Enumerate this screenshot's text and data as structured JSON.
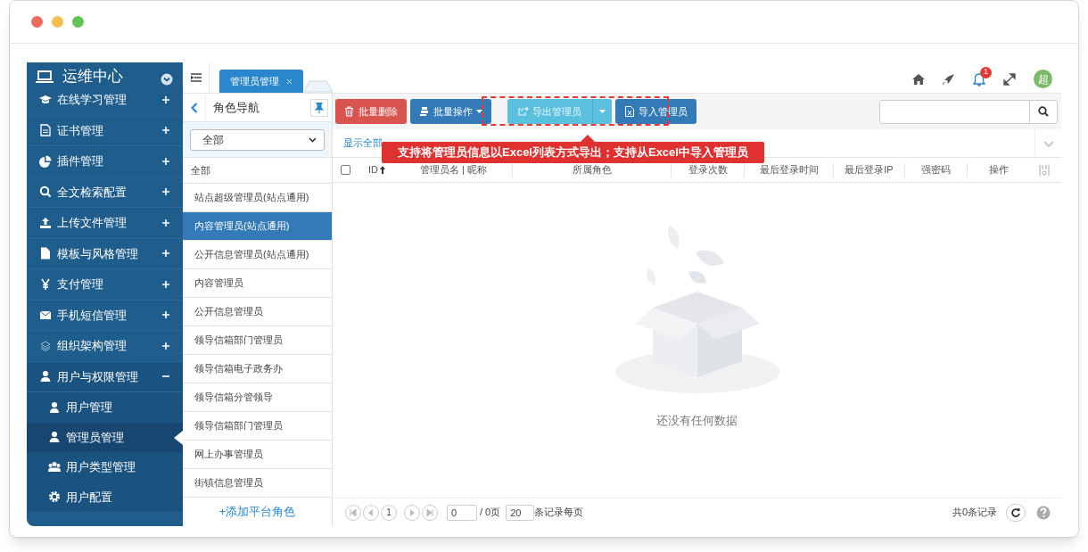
{
  "app": {
    "title": "运维中心"
  },
  "sidebar": {
    "items": [
      {
        "label": "在线学习管理",
        "expanded": false,
        "selected": false
      },
      {
        "label": "证书管理",
        "expanded": false,
        "selected": false
      },
      {
        "label": "插件管理",
        "expanded": false,
        "selected": false
      },
      {
        "label": "全文检索配置",
        "expanded": false,
        "selected": false
      },
      {
        "label": "上传文件管理",
        "expanded": false,
        "selected": false
      },
      {
        "label": "模板与风格管理",
        "expanded": false,
        "selected": false
      },
      {
        "label": "支付管理",
        "expanded": false,
        "selected": false
      },
      {
        "label": "手机短信管理",
        "expanded": false,
        "selected": false
      },
      {
        "label": "组织架构管理",
        "expanded": false,
        "selected": false
      },
      {
        "label": "用户与权限管理",
        "expanded": true,
        "selected": false,
        "children": [
          {
            "label": "用户管理",
            "selected": false
          },
          {
            "label": "管理员管理",
            "selected": true
          },
          {
            "label": "用户类型管理",
            "selected": false
          },
          {
            "label": "用户配置",
            "selected": false
          }
        ]
      }
    ]
  },
  "tabs": [
    {
      "label": "管理员管理",
      "selected": true
    }
  ],
  "topbar": {
    "notification_count": "1",
    "avatar": "超"
  },
  "role_panel": {
    "title": "角色导航",
    "filter": "全部",
    "items": [
      {
        "label": "全部",
        "selected": false
      },
      {
        "label": "站点超级管理员(站点通用)",
        "selected": false
      },
      {
        "label": "内容管理员(站点通用)",
        "selected": true
      },
      {
        "label": "公开信息管理员(站点通用)",
        "selected": false
      },
      {
        "label": "内容管理员",
        "selected": false
      },
      {
        "label": "公开信息管理员",
        "selected": false
      },
      {
        "label": "领导信箱部门管理员",
        "selected": false
      },
      {
        "label": "领导信箱电子政务办",
        "selected": false
      },
      {
        "label": "领导信箱分管领导",
        "selected": false
      },
      {
        "label": "领导信箱部门管理员",
        "selected": false
      },
      {
        "label": "网上办事管理员",
        "selected": false
      },
      {
        "label": "街镇信息管理员",
        "selected": false
      }
    ],
    "add_button": "+添加平台角色"
  },
  "toolbar": {
    "buttons": [
      {
        "kind": "delete",
        "label": "批量删除"
      },
      {
        "kind": "batch",
        "label": "批量操作"
      },
      {
        "kind": "export",
        "label": "导出管理员"
      },
      {
        "kind": "import",
        "label": "导入管理员"
      }
    ]
  },
  "filters": [
    {
      "label": "显示全部",
      "selected": true
    }
  ],
  "callout": "支持将管理员信息以Excel列表方式导出；支持从Excel中导入管理员",
  "table": {
    "select_all_checked": false,
    "columns": [
      "ID",
      "管理员名 | 昵称",
      "所属角色",
      "登录次数",
      "最后登录时间",
      "最后登录IP",
      "强密码",
      "操作"
    ],
    "empty_text": "还没有任何数据"
  },
  "pager": {
    "page": "1",
    "page_input": "0",
    "total_pages": "/ 0页",
    "page_size": "20",
    "page_size_label": "条记录每页",
    "total": "共0条记录"
  }
}
